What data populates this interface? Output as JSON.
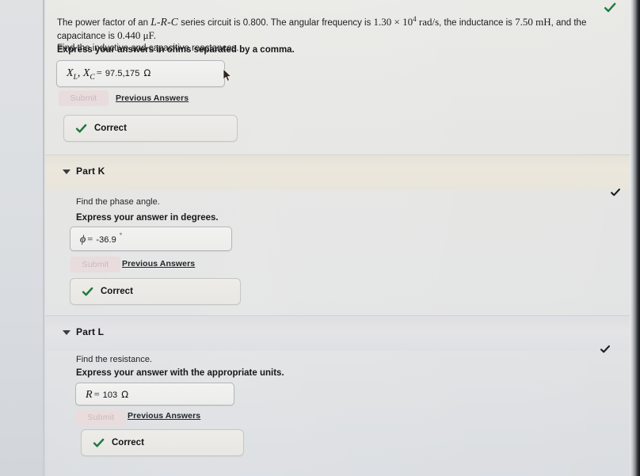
{
  "problem": {
    "intro_pre": "The power factor of an ",
    "circuit_label": "L-R-C",
    "intro_mid": " series circuit is 0.800. The angular frequency is ",
    "ang_freq_value": "1.30 × 10",
    "ang_freq_exp": "4",
    "ang_freq_unit": " rad/s",
    "intro_mid2": ", the inductance is ",
    "inductance": "7.50 mH",
    "intro_mid3": ", and the capacitance is ",
    "capacitance": "0.440 μF",
    "intro_end": ".",
    "second_line": "Find the inductive and capacitive reactances."
  },
  "part_j": {
    "express_instruction": "Express your answers in ohms separated by a comma.",
    "answer": {
      "label_x": "X",
      "label_x_sub_l": "L",
      "label_comma": ", ",
      "label_x2": "X",
      "label_x_sub_c": "C",
      "equals": "=",
      "value": "97.5,175",
      "unit": "Ω"
    },
    "submit_label": "Submit",
    "previous_answers_label": "Previous Answers",
    "status_label": "Correct"
  },
  "part_k": {
    "title": "Part K",
    "find_text": "Find the phase angle.",
    "express_instruction": "Express your answer in degrees.",
    "answer": {
      "symbol": "ϕ",
      "equals": "=",
      "value": "-36.9",
      "unit": "°"
    },
    "submit_label": "Submit",
    "previous_answers_label": "Previous Answers",
    "status_label": "Correct"
  },
  "part_l": {
    "title": "Part L",
    "find_text": "Find the resistance.",
    "express_instruction": "Express your answer with the appropriate units.",
    "answer": {
      "symbol": "R",
      "equals": "=",
      "value": "103",
      "unit": "Ω"
    },
    "submit_label": "Submit",
    "previous_answers_label": "Previous Answers",
    "status_label": "Correct"
  },
  "icons": {
    "correct_check": "check-icon",
    "collapse_caret": "caret-down-icon",
    "edge_check": "check-icon",
    "cursor": "mouse-cursor-icon"
  },
  "colors": {
    "check_green": "#1c7a3c",
    "check_dark": "#1c1d20",
    "page_bg": "#e6e6e4",
    "band_warm": "#ece7dd",
    "band_cool": "#e2e3e6",
    "submit_disabled_bg": "#e8dcdd",
    "submit_disabled_text": "#cbb9bb"
  }
}
